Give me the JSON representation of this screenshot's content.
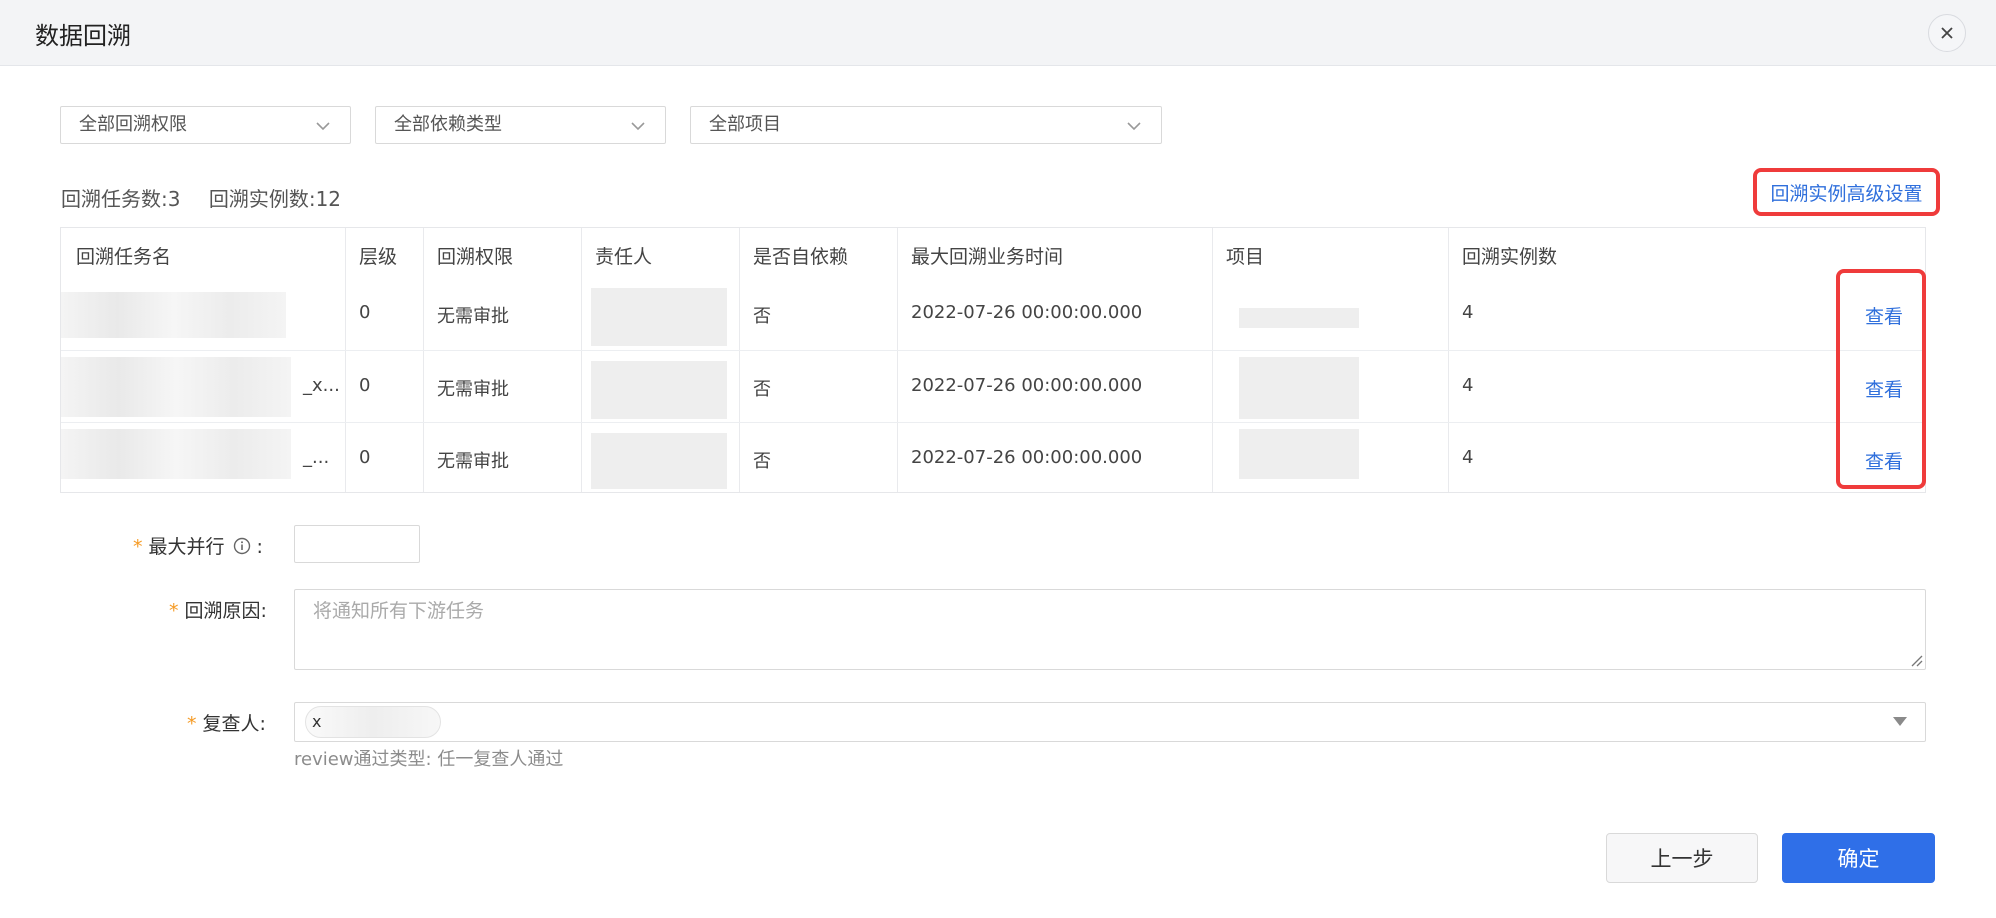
{
  "dialog": {
    "title": "数据回溯"
  },
  "filters": [
    {
      "value": "全部回溯权限"
    },
    {
      "value": "全部依赖类型"
    },
    {
      "value": "全部项目"
    }
  ],
  "stats": {
    "task_count_label": "回溯任务数:3",
    "instance_count_label": "回溯实例数:12"
  },
  "advanced_link": "回溯实例高级设置",
  "table": {
    "headers": [
      "回溯任务名",
      "层级",
      "回溯权限",
      "责任人",
      "是否自依赖",
      "最大回溯业务时间",
      "项目",
      "回溯实例数"
    ],
    "rows": [
      {
        "name_suffix": "",
        "level": "0",
        "permission": "无需审批",
        "self_dep": "否",
        "max_time": "2022-07-26 00:00:00.000",
        "instances": "4",
        "action": "查看"
      },
      {
        "name_suffix": "_x...",
        "level": "0",
        "permission": "无需审批",
        "self_dep": "否",
        "max_time": "2022-07-26 00:00:00.000",
        "instances": "4",
        "action": "查看"
      },
      {
        "name_suffix": "_...",
        "level": "0",
        "permission": "无需审批",
        "self_dep": "否",
        "max_time": "2022-07-26 00:00:00.000",
        "instances": "4",
        "action": "查看"
      }
    ]
  },
  "form": {
    "max_parallel_label": "最大并行",
    "reason_label": "回溯原因",
    "reason_placeholder": "将通知所有下游任务",
    "reviewer_label": "复查人",
    "reviewer_tag": "x",
    "review_hint": "review通过类型: 任一复查人通过",
    "colon": ":"
  },
  "buttons": {
    "prev": "上一步",
    "confirm": "确定"
  },
  "colors": {
    "primary": "#2f6fe8",
    "link": "#2f6fdc",
    "highlight": "#ef3b3b",
    "required": "#f59a23"
  }
}
